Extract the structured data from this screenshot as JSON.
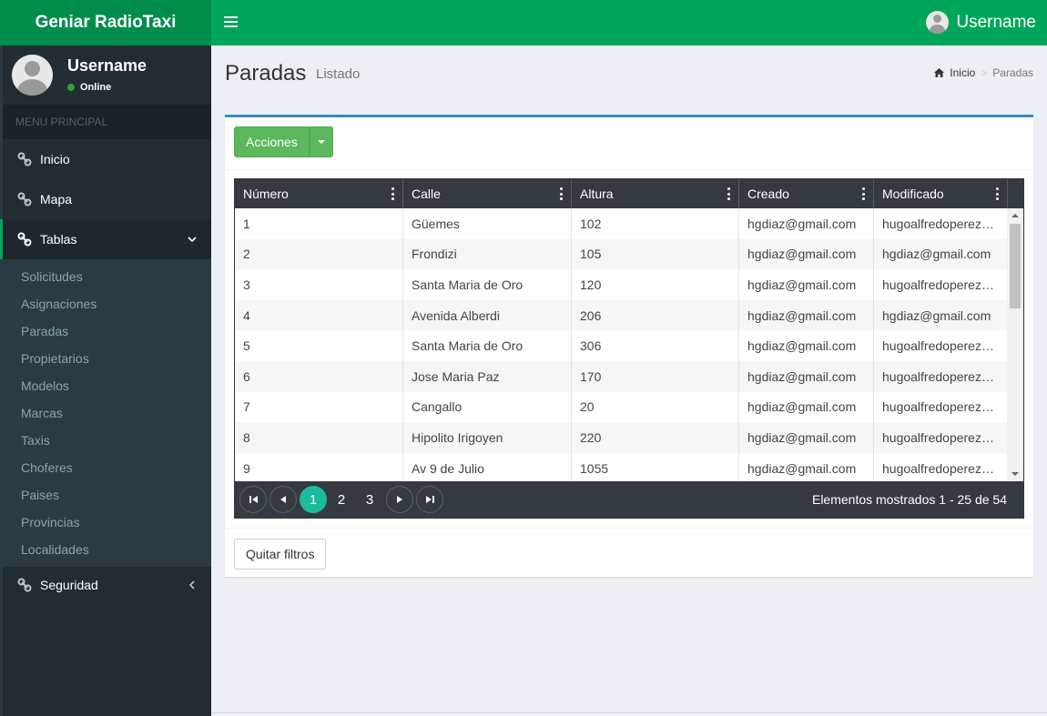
{
  "brand": "Geniar RadioTaxi",
  "header": {
    "username": "Username"
  },
  "sidebar": {
    "user": {
      "name": "Username",
      "status": "Online"
    },
    "menu_header": "MENU PRINCIPAL",
    "items": [
      {
        "label": "Inicio"
      },
      {
        "label": "Mapa"
      },
      {
        "label": "Tablas"
      },
      {
        "label": "Seguridad"
      }
    ],
    "tablas_sub": [
      "Solicitudes",
      "Asignaciones",
      "Paradas",
      "Propietarios",
      "Modelos",
      "Marcas",
      "Taxis",
      "Choferes",
      "Paises",
      "Provincias",
      "Localidades"
    ]
  },
  "page": {
    "title": "Paradas",
    "subtitle": "Listado"
  },
  "breadcrumb": {
    "home": "Inicio",
    "current": "Paradas"
  },
  "actions_label": "Acciones",
  "grid": {
    "columns": [
      "Número",
      "Calle",
      "Altura",
      "Creado",
      "Modificado"
    ],
    "rows": [
      [
        "1",
        "Güemes",
        "102",
        "hgdiaz@gmail.com",
        "hugoalfredoperez…"
      ],
      [
        "2",
        "Frondizi",
        "105",
        "hgdiaz@gmail.com",
        "hgdiaz@gmail.com"
      ],
      [
        "3",
        "Santa Maria de Oro",
        "120",
        "hgdiaz@gmail.com",
        "hugoalfredoperez…"
      ],
      [
        "4",
        "Avenida Alberdi",
        "206",
        "hgdiaz@gmail.com",
        "hgdiaz@gmail.com"
      ],
      [
        "5",
        "Santa Maria de Oro",
        "306",
        "hgdiaz@gmail.com",
        "hugoalfredoperez…"
      ],
      [
        "6",
        "Jose Maria Paz",
        "170",
        "hgdiaz@gmail.com",
        "hugoalfredoperez…"
      ],
      [
        "7",
        "Cangallo",
        "20",
        "hgdiaz@gmail.com",
        "hugoalfredoperez…"
      ],
      [
        "8",
        "Hipolito Irigoyen",
        "220",
        "hgdiaz@gmail.com",
        "hugoalfredoperez…"
      ],
      [
        "9",
        "Av 9 de Julio",
        "1055",
        "hgdiaz@gmail.com",
        "hugoalfredoperez…"
      ]
    ]
  },
  "pager": {
    "pages": [
      "1",
      "2",
      "3"
    ],
    "active_page": "1",
    "info": "Elementos mostrados 1 - 25 de 54"
  },
  "clear_filters": "Quitar filtros",
  "colors": {
    "topbar": "#00a65a",
    "logo": "#008d4c",
    "sidebar": "#222d32",
    "box_border": "#3c8dbc",
    "active_page": "#1abc9c"
  }
}
